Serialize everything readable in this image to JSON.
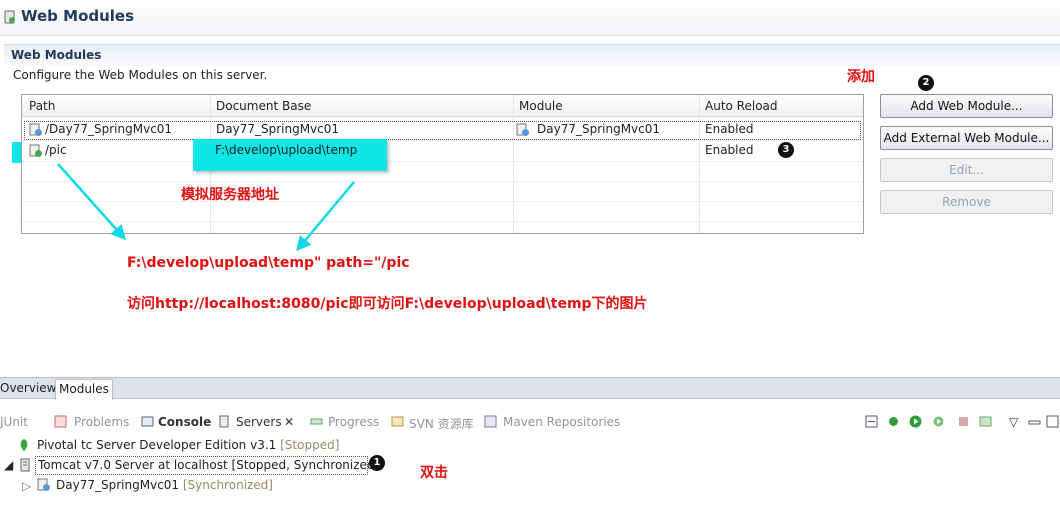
{
  "editor": {
    "title": "Web Modules",
    "section_title": "Web Modules",
    "section_desc": "Configure the Web Modules on this server."
  },
  "table": {
    "columns": [
      "Path",
      "Document Base",
      "Module",
      "Auto Reload"
    ],
    "rows": [
      {
        "path": "/Day77_SpringMvc01",
        "doc_base": "Day77_SpringMvc01",
        "module": "Day77_SpringMvc01",
        "auto_reload": "Enabled"
      },
      {
        "path": "/pic",
        "doc_base": "F:\\develop\\upload\\temp",
        "module": "",
        "auto_reload": "Enabled"
      }
    ]
  },
  "buttons": {
    "add_web_module": "Add Web Module...",
    "add_external": "Add External Web Module...",
    "edit": "Edit...",
    "remove": "Remove"
  },
  "annotations": {
    "add": "添加",
    "sim_server": "模拟服务器地址",
    "line1": "F:\\develop\\upload\\temp\" path=\"/pic",
    "line2": "访问http://localhost:8080/pic即可访问F:\\develop\\upload\\temp下的图片",
    "double_click": "双击",
    "badge1": "1",
    "badge2": "2",
    "badge3": "3"
  },
  "editor_tabs": {
    "overview": "Overview",
    "modules": "Modules"
  },
  "views": {
    "junit": "JUnit",
    "problems": "Problems",
    "console": "Console",
    "servers": "Servers",
    "progress": "Progress",
    "svn": "SVN 资源库",
    "maven": "Maven Repositories"
  },
  "servers": [
    {
      "name": "Pivotal tc Server Developer Edition v3.1",
      "state": "[Stopped]"
    },
    {
      "name": "Tomcat v7.0 Server at localhost",
      "state": "[Stopped, Synchronized]"
    }
  ],
  "child_module": {
    "name": "Day77_SpringMvc01",
    "state": "[Synchronized]"
  },
  "colors": {
    "accent_cyan": "#10e6e6",
    "annotation_red": "#e01010",
    "title_blue": "#213b5c"
  }
}
